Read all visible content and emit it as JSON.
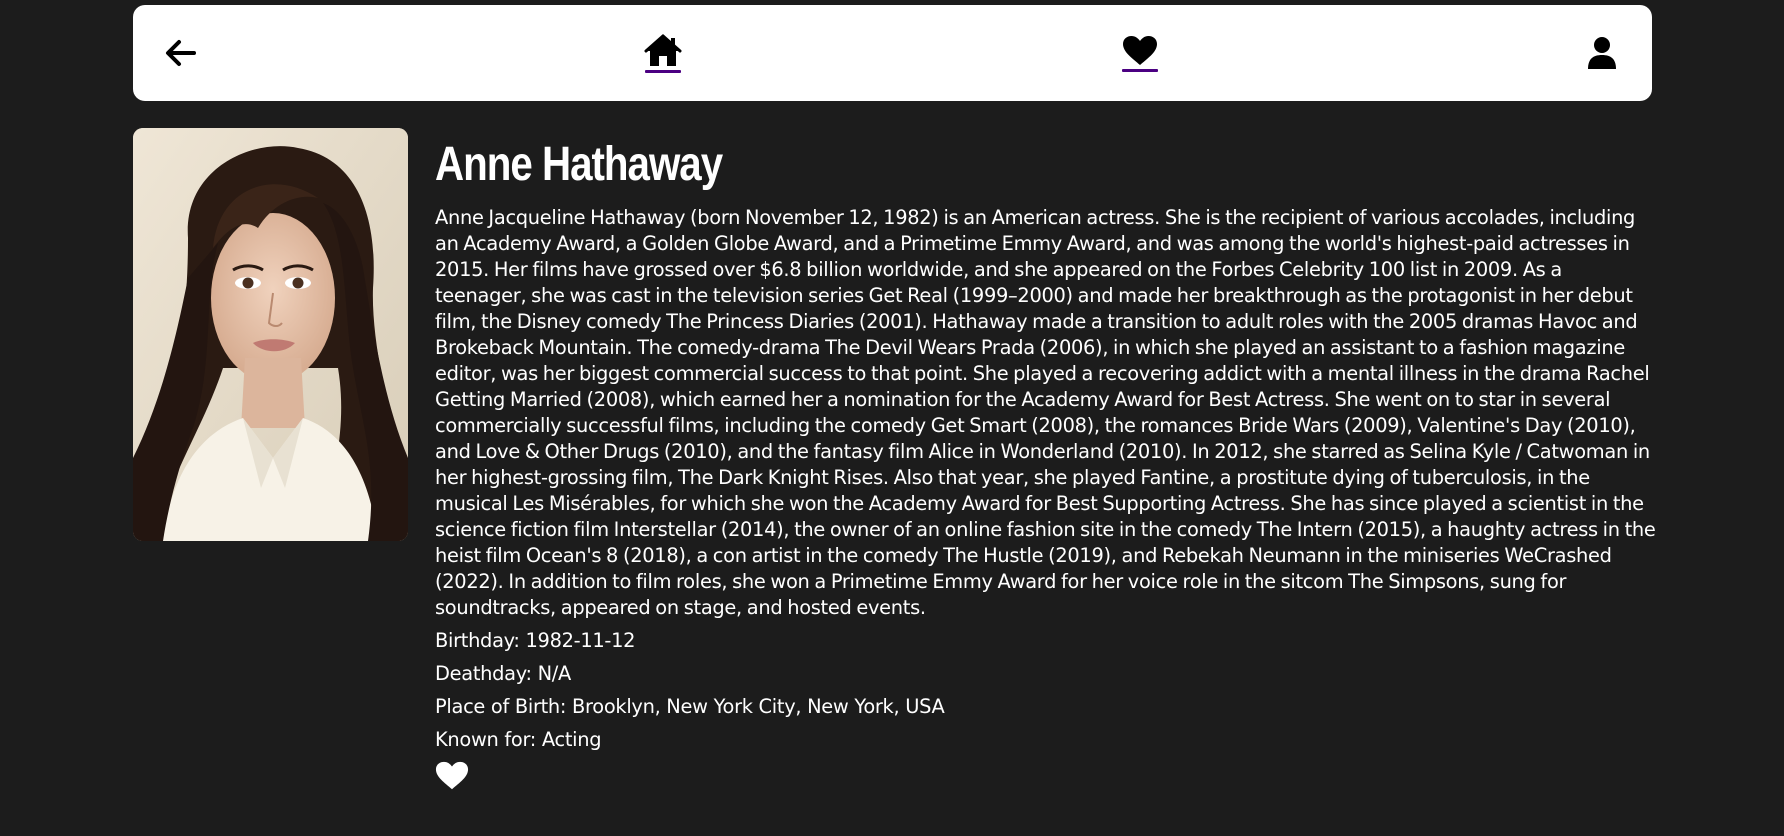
{
  "nav": {
    "icons": [
      "back-arrow-icon",
      "home-icon",
      "heart-icon",
      "user-icon"
    ],
    "underline_color": "#4b0082"
  },
  "person": {
    "name": "Anne Hathaway",
    "biography": "Anne Jacqueline Hathaway (born November 12, 1982) is an American actress. She is the recipient of various accolades, including an Academy Award, a Golden Globe Award, and a Primetime Emmy Award, and was among the world's highest-paid actresses in 2015. Her films have grossed over $6.8 billion worldwide, and she appeared on the Forbes Celebrity 100 list in 2009. As a teenager, she was cast in the television series Get Real (1999–2000) and made her breakthrough as the protagonist in her debut film, the Disney comedy The Princess Diaries (2001). Hathaway made a transition to adult roles with the 2005 dramas Havoc and Brokeback Mountain. The comedy-drama The Devil Wears Prada (2006), in which she played an assistant to a fashion magazine editor, was her biggest commercial success to that point. She played a recovering addict with a mental illness in the drama Rachel Getting Married (2008), which earned her a nomination for the Academy Award for Best Actress. She went on to star in several commercially successful films, including the comedy Get Smart (2008), the romances Bride Wars (2009), Valentine's Day (2010), and Love & Other Drugs (2010), and the fantasy film Alice in Wonderland (2010). In 2012, she starred as Selina Kyle / Catwoman in her highest-grossing film, The Dark Knight Rises. Also that year, she played Fantine, a prostitute dying of tuberculosis, in the musical Les Misérables, for which she won the Academy Award for Best Supporting Actress. She has since played a scientist in the science fiction film Interstellar (2014), the owner of an online fashion site in the comedy The Intern (2015), a haughty actress in the heist film Ocean's 8 (2018), a con artist in the comedy The Hustle (2019), and Rebekah Neumann in the miniseries WeCrashed (2022). In addition to film roles, she won a Primetime Emmy Award for her voice role in the sitcom The Simpsons, sung for soundtracks, appeared on stage, and hosted events.",
    "birthday": "Birthday: 1982-11-12",
    "deathday": "Deathday: N/A",
    "place_of_birth": "Place of Birth: Brooklyn, New York City, New York, USA",
    "known_for": "Known for: Acting",
    "favorite_icon": "heart-outline-icon"
  },
  "colors": {
    "background": "#1c1c1c",
    "navbar": "#ffffff",
    "text": "#ffffff"
  }
}
